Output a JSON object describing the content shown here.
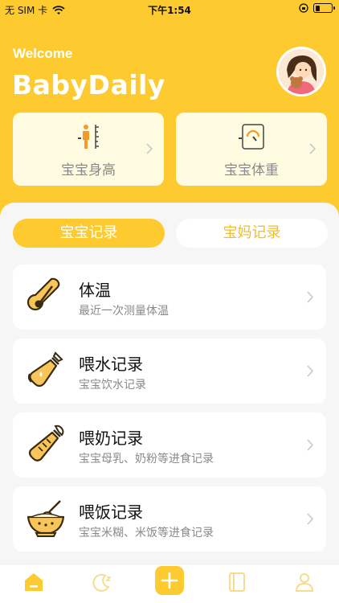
{
  "status_bar": {
    "carrier": "无 SIM 卡",
    "time": "下午1:54",
    "battery_level": 0.3
  },
  "header": {
    "welcome": "Welcome",
    "app_name": "BabyDaily"
  },
  "metrics": [
    {
      "label": "宝宝身高",
      "icon": "height-icon"
    },
    {
      "label": "宝宝体重",
      "icon": "scale-icon"
    }
  ],
  "tabs": [
    {
      "label": "宝宝记录",
      "active": true
    },
    {
      "label": "宝妈记录",
      "active": false
    }
  ],
  "records": [
    {
      "title": "体温",
      "subtitle": "最近一次测量体温",
      "icon": "thermometer-icon"
    },
    {
      "title": "喂水记录",
      "subtitle": "宝宝饮水记录",
      "icon": "water-bottle-icon"
    },
    {
      "title": "喂奶记录",
      "subtitle": "宝宝母乳、奶粉等进食记录",
      "icon": "milk-bottle-icon"
    },
    {
      "title": "喂饭记录",
      "subtitle": "宝宝米糊、米饭等进食记录",
      "icon": "rice-bowl-icon"
    }
  ],
  "tabbar": [
    {
      "name": "home",
      "icon": "home-icon",
      "active": true
    },
    {
      "name": "sleep",
      "icon": "moon-icon",
      "active": false
    },
    {
      "name": "add",
      "icon": "plus-icon",
      "active": false
    },
    {
      "name": "diary",
      "icon": "book-icon",
      "active": false
    },
    {
      "name": "profile",
      "icon": "user-icon",
      "active": false
    }
  ],
  "colors": {
    "accent": "#fdcb2f",
    "card_bg": "#fffbe1",
    "icon_brown": "#3a2a10",
    "icon_fill": "#f7c55a"
  }
}
